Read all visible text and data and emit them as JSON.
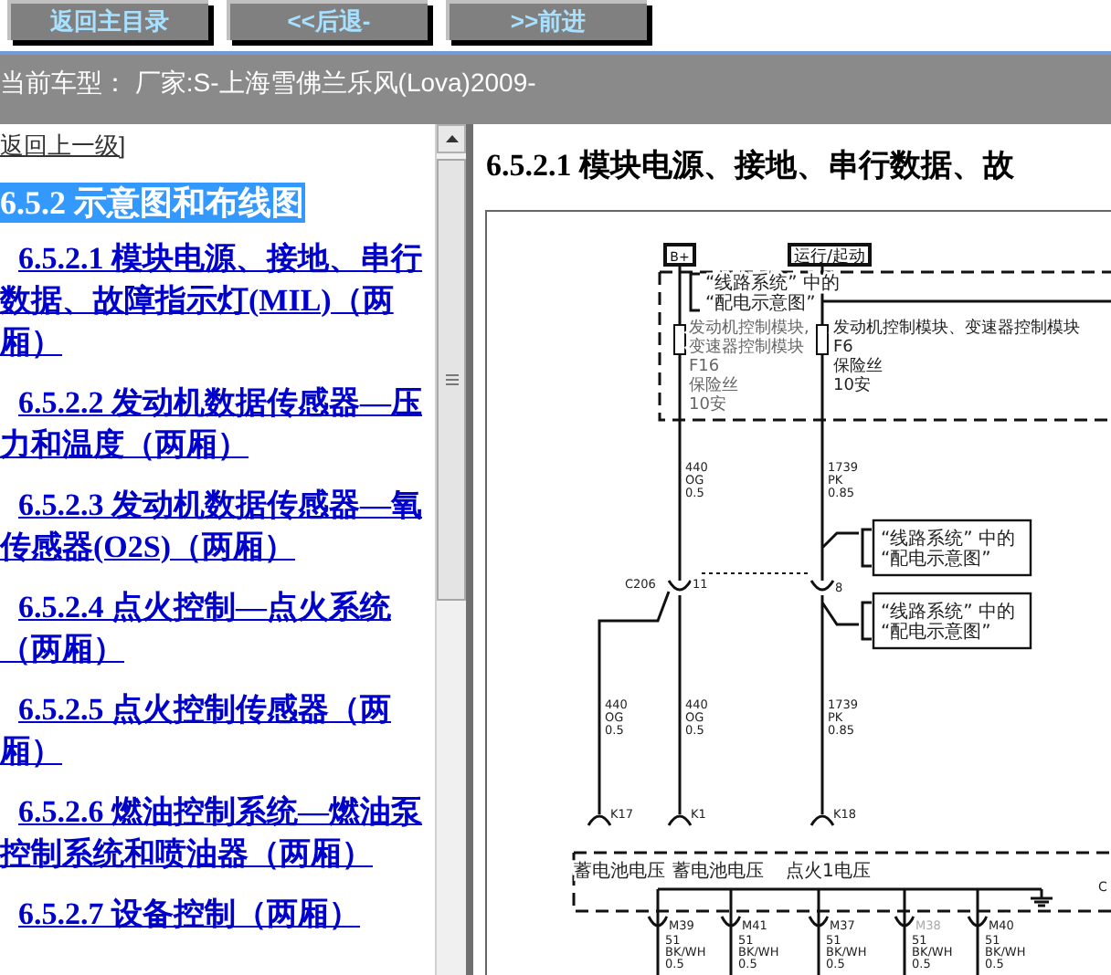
{
  "toolbar": {
    "buttons": [
      "返回主目录",
      "<<后退-",
      ">>前进"
    ]
  },
  "status_bar": {
    "text": "当前车型：  厂家:S-上海雪佛兰乐风(Lova)2009-"
  },
  "sidebar": {
    "back_link": "返回上一级]",
    "heading": {
      "text": "6.5.2 示意图和布线图",
      "selected": true
    },
    "items": [
      {
        "text": "6.5.2.1 模块电源、接地、串行数据、故障指示灯(MIL)（两厢）"
      },
      {
        "text": "6.5.2.2 发动机数据传感器—压力和温度（两厢）"
      },
      {
        "text": "6.5.2.3 发动机数据传感器—氧传感器(O2S)（两厢）"
      },
      {
        "text": "6.5.2.4 点火控制—点火系统（两厢）"
      },
      {
        "text": "6.5.2.5 点火控制传感器（两厢）"
      },
      {
        "text": "6.5.2.6 燃油控制系统—燃油泵控制系统和喷油器（两厢）"
      },
      {
        "text": "6.5.2.7 设备控制（两厢）"
      }
    ]
  },
  "content": {
    "title": "6.5.2.1 模块电源、接地、串行数据、故",
    "diagram": {
      "power_labels": [
        "B+",
        "运行/起动"
      ],
      "reference_boxes": [
        {
          "lines": [
            "“线路系统” 中的",
            "“配电示意图”"
          ]
        },
        {
          "lines": [
            "“线路系统” 中的",
            "“配电示意图”"
          ]
        },
        {
          "lines": [
            "“线路系统” 中的",
            "“配电示意图”"
          ]
        }
      ],
      "fuses": [
        {
          "lines": [
            "发动机控制模块,",
            "变速器控制模块",
            "F16",
            "保险丝",
            "10安"
          ]
        },
        {
          "lines": [
            "发动机控制模块、变速器控制模块",
            "F6",
            "保险丝",
            "10安"
          ]
        }
      ],
      "wire_labels": [
        {
          "lines": [
            "440",
            "OG",
            "0.5"
          ]
        },
        {
          "lines": [
            "1739",
            "PK",
            "0.85"
          ]
        },
        {
          "lines": [
            "440",
            "OG",
            "0.5"
          ]
        },
        {
          "lines": [
            "440",
            "OG",
            "0.5"
          ]
        },
        {
          "lines": [
            "1739",
            "PK",
            "0.85"
          ]
        }
      ],
      "connector_labels": [
        "C206",
        "11",
        "8"
      ],
      "terminals": [
        {
          "pin": "K17",
          "signal": "蓄电池电压"
        },
        {
          "pin": "K1",
          "signal": "蓄电池电压"
        },
        {
          "pin": "K18",
          "signal": "点火1电压"
        }
      ],
      "grounds": [
        {
          "pin": "M39",
          "dimmed": false,
          "lines": [
            "51",
            "BK/WH",
            "0.5"
          ]
        },
        {
          "pin": "M41",
          "dimmed": false,
          "lines": [
            "51",
            "BK/WH",
            "0.5"
          ]
        },
        {
          "pin": "M37",
          "dimmed": false,
          "lines": [
            "51",
            "BK/WH",
            "0.5"
          ]
        },
        {
          "pin": "M38",
          "dimmed": true,
          "lines": [
            "51",
            "BK/WH",
            "0.5"
          ]
        },
        {
          "pin": "M40",
          "dimmed": false,
          "lines": [
            "51",
            "BK/WH",
            "0.5"
          ]
        }
      ],
      "edge_text": "C"
    }
  }
}
